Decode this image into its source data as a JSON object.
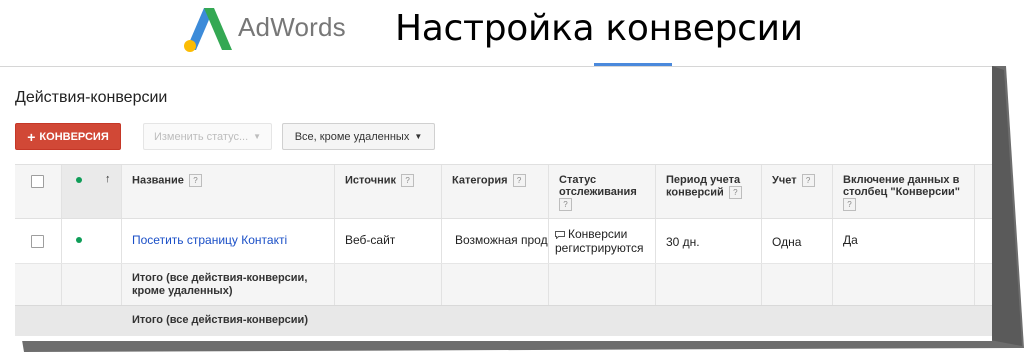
{
  "header": {
    "logo_text": "AdWords",
    "slide_title": "Настройка конверсии",
    "accent_color": "#4a89dc"
  },
  "page": {
    "section_title": "Действия-конверсии"
  },
  "toolbar": {
    "add_button_label": "КОНВЕРСИЯ",
    "add_button_icon": "plus-icon",
    "add_button_color": "#d14836",
    "change_status_label": "Изменить статус...",
    "filter_label": "Все, кроме удаленных"
  },
  "table": {
    "help_mark": "?",
    "sort_indicator": "↑",
    "columns": {
      "name": "Название",
      "source": "Источник",
      "category": "Категория",
      "tracking_status_1": "Статус",
      "tracking_status_2": "отслеживания",
      "period_1": "Период учета",
      "period_2": "конверсий",
      "count": "Учет",
      "include_1": "Включение данных в",
      "include_2": "столбец \"Конверсии\""
    },
    "rows": [
      {
        "name": "Посетить страницу Контакті",
        "source": "Веб-сайт",
        "category": "Возможная продажа",
        "status_1": "Конверсии",
        "status_2": "регистрируются",
        "status_icon": "comment-icon",
        "period": "30 дн.",
        "count": "Одна",
        "include": "Да",
        "status_dot_color": "#0f9d58"
      }
    ],
    "totals": [
      {
        "label_1": "Итого (все действия-конверсии,",
        "label_2": "кроме удаленных)"
      },
      {
        "label_1": "Итого (все действия-конверсии)"
      }
    ]
  }
}
